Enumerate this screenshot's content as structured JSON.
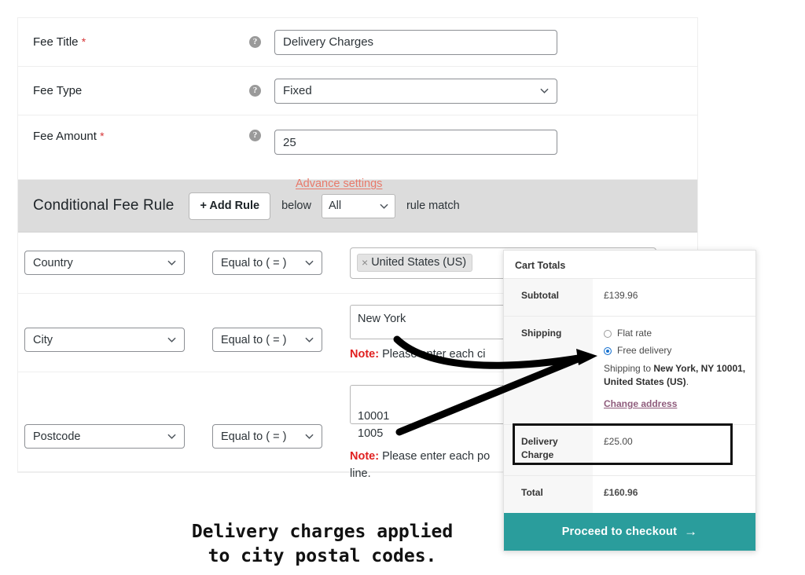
{
  "fee_form": {
    "rows": [
      {
        "label": "Fee Title",
        "required": true,
        "help_icon": "help-circle-icon",
        "control": "text",
        "value": "Delivery Charges"
      },
      {
        "label": "Fee Type",
        "required": false,
        "help_icon": "help-circle-icon",
        "control": "select",
        "value": "Fixed"
      },
      {
        "label": "Fee Amount",
        "required": true,
        "help_icon": "help-circle-icon",
        "control": "text",
        "value": "25"
      }
    ],
    "advance_settings_link": "Advance settings",
    "required_marker": "*"
  },
  "conditional_fee_rule": {
    "title": "Conditional Fee Rule",
    "add_rule_button": "+ Add Rule",
    "below_text": "below",
    "match_select_value": "All",
    "rule_match_text": "rule match",
    "rules": [
      {
        "field": "Country",
        "operator": "Equal to ( = )",
        "value_type": "tags",
        "tags": [
          "United States (US)"
        ],
        "tag_remove_icon": "close-x-icon",
        "note": ""
      },
      {
        "field": "City",
        "operator": "Equal to ( = )",
        "value_type": "textarea",
        "value": "New York",
        "note_label": "Note:",
        "note": " Please enter each ci"
      },
      {
        "field": "Postcode",
        "operator": "Equal to ( = )",
        "value_type": "textarea",
        "value": "10001\n1005",
        "note_label": "Note:",
        "note": " Please enter each po\nline."
      }
    ]
  },
  "cart_totals": {
    "heading": "Cart Totals",
    "rows": [
      {
        "label": "Subtotal",
        "value": "£139.96"
      },
      {
        "label": "Total",
        "value": "£160.96"
      }
    ],
    "shipping": {
      "label": "Shipping",
      "options": [
        {
          "label": "Flat rate",
          "selected": false
        },
        {
          "label": "Free delivery",
          "selected": true
        }
      ],
      "shipping_to_prefix": "Shipping to ",
      "shipping_to_address": "New York, NY 10001, United States (US)",
      "shipping_to_suffix": ".",
      "change_address_link": "Change address"
    },
    "delivery_charge": {
      "label": "Delivery Charge",
      "value": "£25.00"
    },
    "checkout_button": "Proceed to checkout",
    "checkout_arrow_icon": "arrow-right-icon"
  },
  "annotation": {
    "caption": "Delivery charges applied\nto city postal codes.",
    "arrow_icon": "curved-arrow-icon"
  },
  "colors": {
    "teal_button": "#2a9d9c",
    "link_salmon": "#e8796a",
    "link_purple": "#8f5c7c",
    "note_red": "#e02020",
    "required_red": "#d63638",
    "band_gray": "#dcdcdc",
    "radio_blue": "#1a73d0"
  }
}
